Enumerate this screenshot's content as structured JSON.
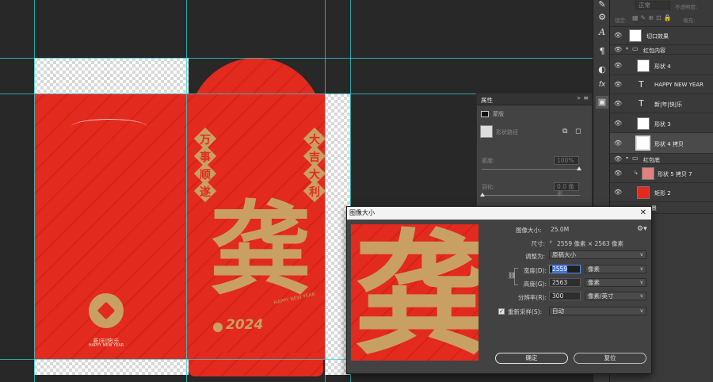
{
  "canvas": {
    "left_panel": {
      "text_cn": "新|年|快|乐",
      "text_en": "HAPPY NEW YEAR"
    },
    "front": {
      "left_vertical": [
        "万",
        "事",
        "顺",
        "遂"
      ],
      "right_vertical": [
        "大",
        "吉",
        "大",
        "利"
      ],
      "big_character": "龚",
      "year": "2024",
      "english": "HAPPY NEW YEAR"
    }
  },
  "properties_panel": {
    "tab": "属性",
    "section": "蒙版",
    "mask_label": "形状路径",
    "density_label": "密度:",
    "density_value": "100%",
    "feather_label": "羽化:",
    "feather_value": "0.0 像素"
  },
  "layers_panel": {
    "blend_mode": "正常",
    "opacity_label": "不透明度:",
    "lock_label": "锁定:",
    "fill_label": "填充:",
    "rows": [
      {
        "name": "切口效果"
      },
      {
        "name": "红包内容"
      },
      {
        "name": "形状 4"
      },
      {
        "name": "HAPPY NEW YEAR"
      },
      {
        "name": "新|年|快|乐"
      },
      {
        "name": "形状 3"
      },
      {
        "name": "形状 4 拷贝"
      },
      {
        "name": "红包底"
      },
      {
        "name": "形状 5 拷贝 7"
      },
      {
        "name": "矩形 2"
      },
      {
        "name": "景"
      }
    ]
  },
  "dialog": {
    "title": "图像大小",
    "close_icon": "close-icon",
    "image_size_label": "图像大小:",
    "image_size_value": "25.0M",
    "dimensions_label": "尺寸:",
    "dimensions_value": "2559 像素 × 2563 像素",
    "fit_label": "调整为:",
    "fit_value": "原稿大小",
    "width_label": "宽度(D):",
    "width_value": "2559",
    "width_unit": "像素",
    "height_label": "高度(G):",
    "height_value": "2563",
    "height_unit": "像素",
    "resolution_label": "分辨率(R):",
    "resolution_value": "300",
    "resolution_unit": "像素/英寸",
    "resample_label": "重新采样(S):",
    "resample_checked": true,
    "resample_value": "自动",
    "ok_label": "确定",
    "reset_label": "复位",
    "preview_character": "龚"
  },
  "colors": {
    "envelope_red": "#e32a1f",
    "gold": "#c9a063",
    "guide": "#2bd6d6"
  }
}
